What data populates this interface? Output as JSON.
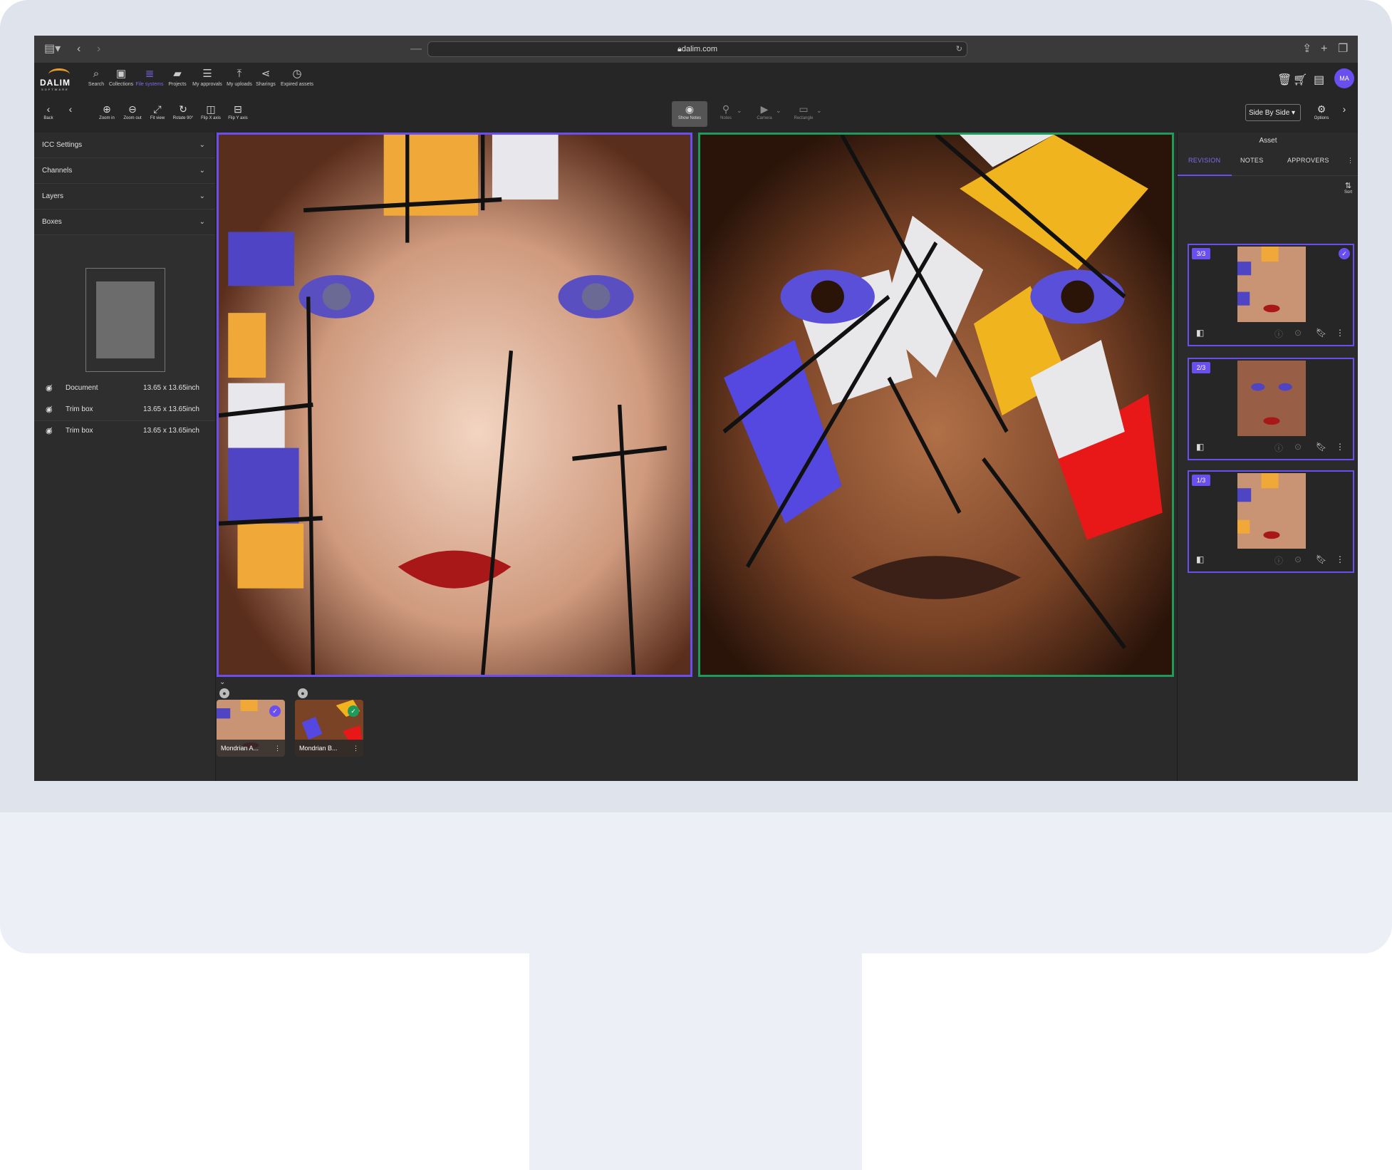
{
  "browser": {
    "url": "dalim.com",
    "icons": [
      "sidebar-icon",
      "back-icon",
      "forward-icon",
      "share-icon",
      "new-tab-icon",
      "tabs-icon",
      "reload-icon"
    ]
  },
  "nav": {
    "logo_text": "DALIM",
    "logo_sub": "SOFTWARE",
    "items": [
      {
        "label": "Search",
        "icon": "search-icon"
      },
      {
        "label": "Collections",
        "icon": "collections-icon"
      },
      {
        "label": "File systems",
        "icon": "database-icon"
      },
      {
        "label": "Projects",
        "icon": "briefcase-icon"
      },
      {
        "label": "My approvals",
        "icon": "checklist-icon"
      },
      {
        "label": "My uploads",
        "icon": "upload-icon"
      },
      {
        "label": "Sharings",
        "icon": "share-icon"
      },
      {
        "label": "Expired assets",
        "icon": "clock-icon"
      }
    ],
    "active_index": 2,
    "user_initials": "MA"
  },
  "toolbar": {
    "back_label": "Back",
    "tools": [
      {
        "label": "Zoom in",
        "icon": "zoom-in-icon"
      },
      {
        "label": "Zoom out",
        "icon": "zoom-out-icon"
      },
      {
        "label": "Fit view",
        "icon": "fit-view-icon"
      },
      {
        "label": "Rotate 90°",
        "icon": "rotate-icon"
      },
      {
        "label": "Flip X axis",
        "icon": "flip-x-icon"
      },
      {
        "label": "Flip Y axis",
        "icon": "flip-y-icon"
      }
    ],
    "center_tools": [
      {
        "label": "Show Notes",
        "icon": "eye-icon"
      },
      {
        "label": "Notes",
        "icon": "pin-icon"
      },
      {
        "label": "Camera",
        "icon": "camera-icon"
      },
      {
        "label": "Rectangle",
        "icon": "rectangle-icon"
      }
    ],
    "view_mode": "Side By Side",
    "options_label": "Options"
  },
  "left_panel": {
    "sections": [
      "ICC Settings",
      "Channels",
      "Layers",
      "Boxes"
    ],
    "boxes": [
      {
        "name": "Document",
        "value": "13.65 x 13.65inch"
      },
      {
        "name": "Trim box",
        "value": "13.65 x 13.65inch"
      },
      {
        "name": "Trim box",
        "value": "13.65 x 13.65inch"
      }
    ]
  },
  "assets": [
    {
      "name": "Mondrian A...",
      "status": "approved-purple"
    },
    {
      "name": "Mondrian B...",
      "status": "approved-green"
    }
  ],
  "right_panel": {
    "title": "Asset",
    "tabs": [
      "REVISION",
      "NOTES",
      "APPROVERS"
    ],
    "active_tab": 0,
    "sort_label": "Sort",
    "revisions": [
      {
        "tag": "3/3",
        "selected": true
      },
      {
        "tag": "2/3",
        "selected": false
      },
      {
        "tag": "1/3",
        "selected": false
      }
    ]
  },
  "colors": {
    "accent": "#6a4ff0",
    "approved": "#1e9b5a",
    "bg": "#2b2b2b"
  }
}
